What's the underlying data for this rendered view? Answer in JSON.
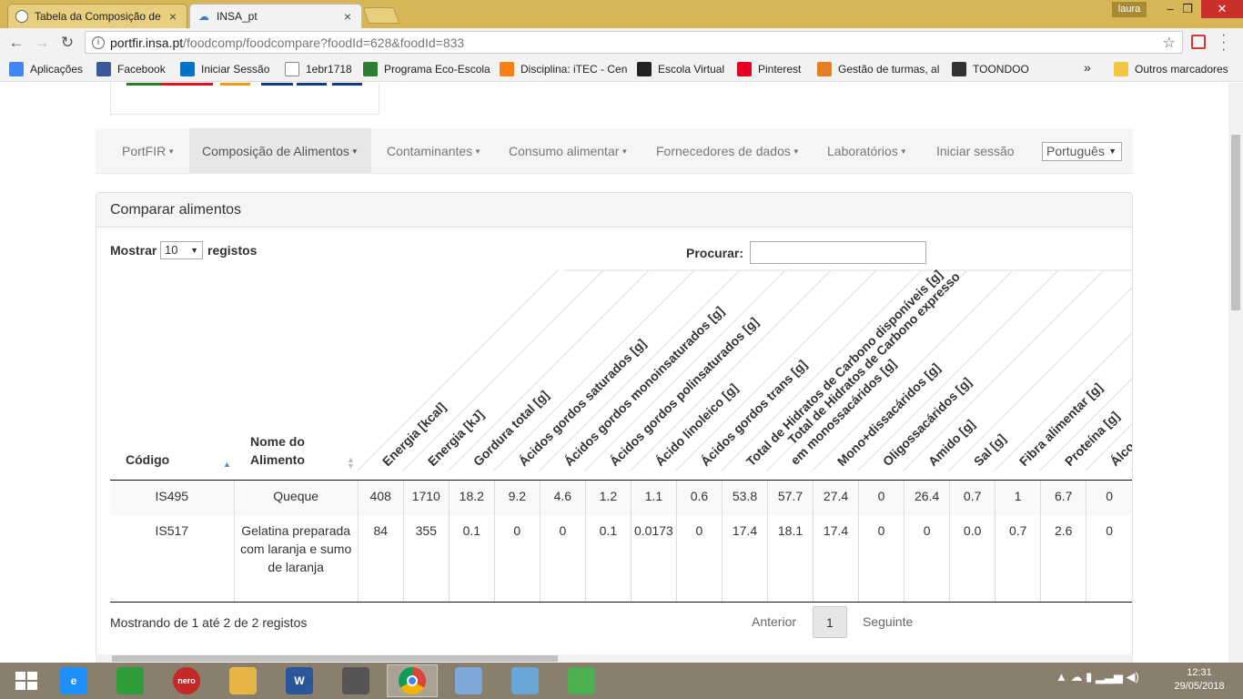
{
  "browser": {
    "tabs": [
      {
        "title": "Tabela da Composição de",
        "active": false
      },
      {
        "title": "INSA_pt",
        "active": true
      }
    ],
    "user": "laura",
    "url_host": "portfir.insa.pt",
    "url_path": "/foodcomp/foodcompare?foodId=628&foodId=833",
    "bookmarks": [
      {
        "label": "Aplicações",
        "icon": "apps-grid-icon",
        "color": "#4285f4"
      },
      {
        "label": "Facebook",
        "icon": "facebook-icon",
        "color": "#3b5998"
      },
      {
        "label": "Iniciar Sessão",
        "icon": "outlook-icon",
        "color": "#0072c6"
      },
      {
        "label": "1ebr1718",
        "icon": "page-icon",
        "color": "#ffffff"
      },
      {
        "label": "Programa Eco-Escola",
        "icon": "eco-escolas-icon",
        "color": "#2e7d32"
      },
      {
        "label": "Disciplina: iTEC - Cen",
        "icon": "moodle-icon",
        "color": "#f98012"
      },
      {
        "label": "Escola Virtual",
        "icon": "escola-virtual-icon",
        "color": "#222222"
      },
      {
        "label": "Pinterest",
        "icon": "pinterest-icon",
        "color": "#e60023"
      },
      {
        "label": "Gestão de turmas, al",
        "icon": "gestao-icon",
        "color": "#e67e22"
      },
      {
        "label": "TOONDOO",
        "icon": "toondoo-icon",
        "color": "#333333"
      }
    ],
    "bookmarks_more": "»",
    "other_bookmarks": "Outros marcadores"
  },
  "nav": {
    "items": [
      "PortFIR",
      "Composição de Alimentos",
      "Contaminantes",
      "Consumo alimentar",
      "Fornecedores de dados",
      "Laboratórios",
      "Iniciar sessão"
    ],
    "language": "Português"
  },
  "panel": {
    "title": "Comparar alimentos"
  },
  "table_controls": {
    "show_label": "Mostrar",
    "length_value": "10",
    "records_label": "registos",
    "search_label": "Procurar:",
    "search_value": ""
  },
  "columns": {
    "code": "Código",
    "name_line1": "Nome do",
    "name_line2": "Alimento",
    "nutrients": [
      "Energia [kcal]",
      "Energia [kJ]",
      "Gordura total [g]",
      "Ácidos gordos saturados [g]",
      "Ácidos gordos monoinsaturados [g]",
      "Ácidos gordos polinsaturados [g]",
      "Ácido linoleico [g]",
      "Ácidos gordos trans [g]",
      "Total de Hidratos de Carbono disponíveis [g]",
      "Total de Hidratos de Carbono expresso em monossacáridos [g]",
      "Mono+dissacáridos [g]",
      "Oligossacáridos [g]",
      "Amido [g]",
      "Sal [g]",
      "Fibra alimentar [g]",
      "Proteína [g]",
      "Álco"
    ]
  },
  "rows": [
    {
      "code": "IS495",
      "name": "Queque",
      "values": [
        "408",
        "1710",
        "18.2",
        "9.2",
        "4.6",
        "1.2",
        "1.1",
        "0.6",
        "53.8",
        "57.7",
        "27.4",
        "0",
        "26.4",
        "0.7",
        "1",
        "6.7",
        "0"
      ]
    },
    {
      "code": "IS517",
      "name": "Gelatina preparada com laranja e sumo de laranja",
      "values": [
        "84",
        "355",
        "0.1",
        "0",
        "0",
        "0.1",
        "0.0173",
        "0",
        "17.4",
        "18.1",
        "17.4",
        "0",
        "0",
        "0.0",
        "0.7",
        "2.6",
        "0"
      ]
    }
  ],
  "footer": {
    "info": "Mostrando de 1 até 2 de 2 registos",
    "prev": "Anterior",
    "page": "1",
    "next": "Seguinte"
  },
  "taskbar": {
    "apps": [
      {
        "name": "windows-start-icon",
        "glyph": "",
        "color": "#ffffff"
      },
      {
        "name": "internet-explorer-icon",
        "glyph": "e",
        "color": "#1e90ff"
      },
      {
        "name": "store-icon",
        "glyph": "",
        "color": "#2e9d3a"
      },
      {
        "name": "nero-icon",
        "glyph": "nero",
        "color": "#c62828"
      },
      {
        "name": "file-explorer-icon",
        "glyph": "",
        "color": "#e8b548"
      },
      {
        "name": "word-icon",
        "glyph": "W",
        "color": "#2b579a"
      },
      {
        "name": "movie-maker-icon",
        "glyph": "",
        "color": "#555555"
      },
      {
        "name": "chrome-icon",
        "glyph": "",
        "color": "#db4437"
      },
      {
        "name": "calculator-icon",
        "glyph": "",
        "color": "#7da7d9"
      },
      {
        "name": "paint-icon",
        "glyph": "",
        "color": "#6aa6d8"
      },
      {
        "name": "mosaic-app-icon",
        "glyph": "",
        "color": "#4caf50"
      }
    ],
    "time": "12:31",
    "date": "29/05/2018"
  }
}
